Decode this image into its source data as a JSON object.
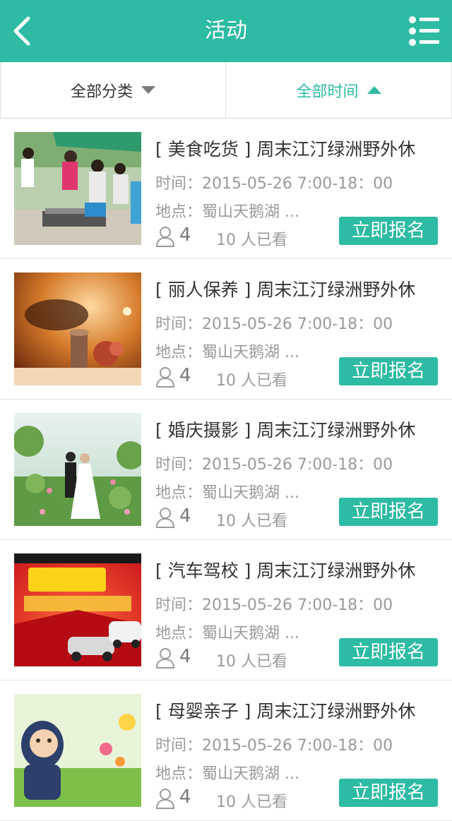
{
  "header": {
    "title": "活动",
    "back_icon": "chevron-left-icon",
    "menu_icon": "list-menu-icon",
    "color": "#2dbba3"
  },
  "filters": {
    "category_label": "全部分类",
    "time_label": "全部时间",
    "active_color": "#2dbba3"
  },
  "events": [
    {
      "title": "[ 美食吃货 ] 周末江汀绿洲野外休",
      "time": "时间：2015-05-26 7:00-18：00",
      "location": "地点：蜀山天鹅湖 ...",
      "count": "4",
      "views": "10 人已看",
      "button": "立即报名"
    },
    {
      "title": "[ 丽人保养 ] 周末江汀绿洲野外休",
      "time": "时间：2015-05-26 7:00-18：00",
      "location": "地点：蜀山天鹅湖 ...",
      "count": "4",
      "views": "10 人已看",
      "button": "立即报名"
    },
    {
      "title": "[ 婚庆摄影 ] 周末江汀绿洲野外休",
      "time": "时间：2015-05-26 7:00-18：00",
      "location": "地点：蜀山天鹅湖 ...",
      "count": "4",
      "views": "10 人已看",
      "button": "立即报名"
    },
    {
      "title": "[ 汽车驾校 ] 周末江汀绿洲野外休",
      "time": "时间：2015-05-26 7:00-18：00",
      "location": "地点：蜀山天鹅湖 ...",
      "count": "4",
      "views": "10 人已看",
      "button": "立即报名"
    },
    {
      "title": "[ 母婴亲子 ] 周末江汀绿洲野外休",
      "time": "时间：2015-05-26 7:00-18：00",
      "location": "地点：蜀山天鹅湖 ...",
      "count": "4",
      "views": "10 人已看",
      "button": "立即报名"
    }
  ]
}
